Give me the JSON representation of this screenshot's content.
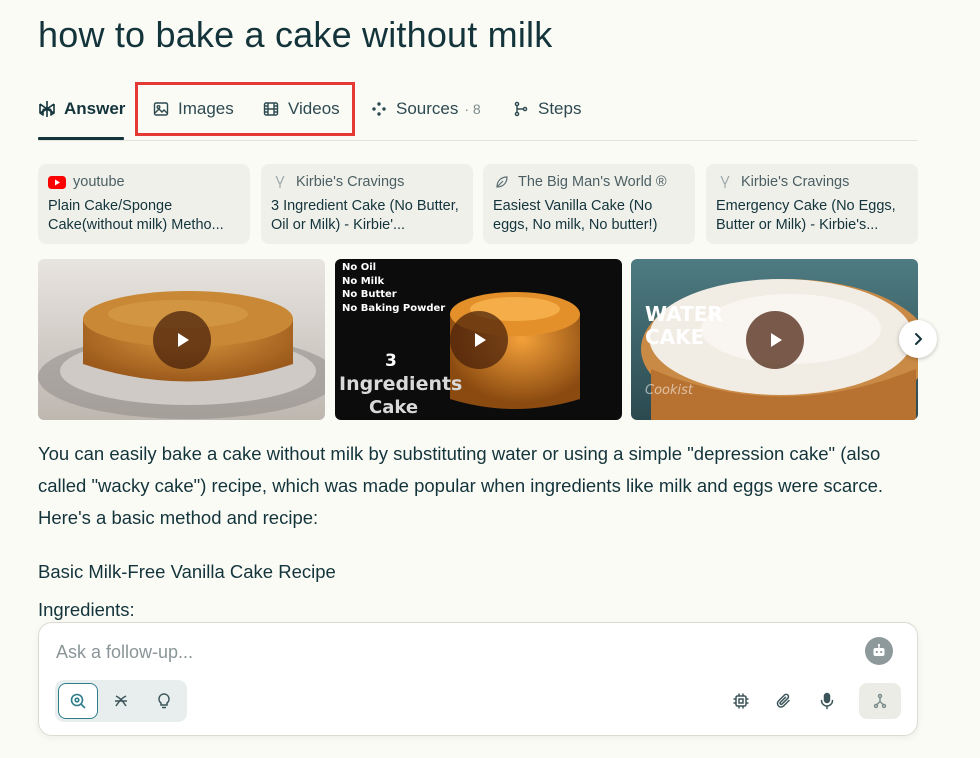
{
  "query": "how to bake a cake without milk",
  "tabs": [
    {
      "label": "Answer",
      "icon": "perplexity-logo-icon"
    },
    {
      "label": "Images",
      "icon": "image-icon"
    },
    {
      "label": "Videos",
      "icon": "film-icon"
    },
    {
      "label": "Sources",
      "icon": "sources-icon",
      "count": "· 8"
    },
    {
      "label": "Steps",
      "icon": "steps-icon"
    }
  ],
  "source_cards": [
    {
      "source": "youtube",
      "title": "Plain Cake/Sponge Cake(without milk) Metho...",
      "icon": "youtube-icon"
    },
    {
      "source": "Kirbie's Cravings",
      "title": "3 Ingredient Cake (No Butter, Oil or Milk) - Kirbie'...",
      "icon": "whisk-icon"
    },
    {
      "source": "The Big Man's World ®",
      "title": "Easiest Vanilla Cake (No eggs, No milk, No butter!)",
      "icon": "leaf-icon"
    },
    {
      "source": "Kirbie's Cravings",
      "title": "Emergency Cake (No Eggs, Butter or Milk) - Kirbie's...",
      "icon": "whisk-icon"
    }
  ],
  "video_thumbs": [
    {
      "overlay": []
    },
    {
      "overlay": [
        "No Oil",
        "No Milk",
        "No Butter",
        "No Baking Powder"
      ],
      "center_number": "3",
      "caption_line1": "Ingredients",
      "caption_line2": "Cake"
    },
    {
      "overlay": [
        "WATER",
        "CAKE"
      ],
      "watermark": "Cookist"
    }
  ],
  "answer": {
    "paragraph": "You can easily bake a cake without milk by substituting water or using a simple \"depression cake\" (also called \"wacky cake\") recipe, which was made popular when ingredients like milk and eggs were scarce. Here's a basic method and recipe:",
    "heading": "Basic Milk-Free Vanilla Cake Recipe",
    "subheading": "Ingredients:"
  },
  "followup": {
    "placeholder": "Ask a follow-up..."
  },
  "colors": {
    "text": "#13343b",
    "accent": "#2f7d8a",
    "highlight": "#e53935",
    "youtube": "#ff0000"
  }
}
